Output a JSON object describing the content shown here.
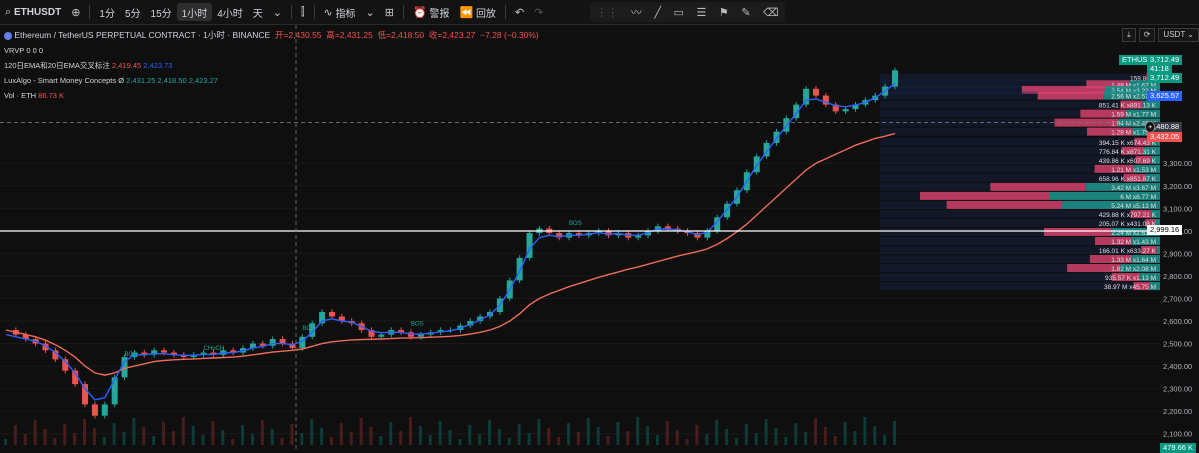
{
  "toolbar": {
    "symbol": "ETHUSDT",
    "intervals": [
      "1分",
      "5分",
      "15分",
      "1小时",
      "4小时",
      "天"
    ],
    "active_interval": "1小时",
    "indicators_label": "指标",
    "alert_label": "警报",
    "replay_label": "回放"
  },
  "legend": {
    "title": "Ethereum / TetherUS PERPETUAL CONTRACT · 1小时 · BINANCE",
    "ohlc": {
      "open_label": "开=",
      "open": "2,430.55",
      "high_label": "高=",
      "high": "2,431.25",
      "low_label": "低=",
      "low": "2,418.50",
      "close_label": "收=",
      "close": "2,423.27",
      "change": "−7.28 (−0.30%)"
    },
    "vrvp": {
      "name": "VRVP",
      "values": "0 0 0"
    },
    "ema": {
      "name": "120日EMA和20日EMA交叉标注",
      "v1": "2,419.45",
      "v2": "2,423.73"
    },
    "luxalgo": {
      "name": "LuxAlgo - Smart Money Concepts",
      "sym": "Ø",
      "values": "2,431.25  2,418.50  2,423.27"
    },
    "vol": {
      "name": "Vol · ETH",
      "value": "86.73 K"
    }
  },
  "right_panel": {
    "currency": "USDT"
  },
  "price_labels": {
    "symbol_tag": "ETHUSDT.P",
    "last_price": "3,712.49",
    "countdown": "41:18",
    "current": "3,712.49",
    "ema_blue": "3,625.57",
    "crosshair": "3,480.88",
    "ema_red": "3,432.05",
    "white_line": "2,999.16",
    "volume": "479.66 K"
  },
  "price_axis": {
    "ticks": [
      {
        "label": "3,300.00",
        "v": 3300
      },
      {
        "label": "3,200.00",
        "v": 3200
      },
      {
        "label": "3,100.00",
        "v": 3100
      },
      {
        "label": "3,000.00",
        "v": 3000
      },
      {
        "label": "2,900.00",
        "v": 2900
      },
      {
        "label": "2,800.00",
        "v": 2800
      },
      {
        "label": "2,700.00",
        "v": 2700
      },
      {
        "label": "2,600.00",
        "v": 2600
      },
      {
        "label": "2,500.00",
        "v": 2500
      },
      {
        "label": "2,400.00",
        "v": 2400
      },
      {
        "label": "2,300.00",
        "v": 2300
      },
      {
        "label": "2,200.00",
        "v": 2200
      },
      {
        "label": "2,100.00",
        "v": 2100
      }
    ]
  },
  "colors": {
    "up": "#26a69a",
    "down": "#ef5350",
    "ema_fast": "#2962ff",
    "ema_slow": "#ef6b5b",
    "vp_pink": "#d4426f",
    "vp_teal": "#1f8f8a",
    "vp_navy": "#1a2a5a"
  },
  "chart_data": {
    "type": "line",
    "title": "Ethereum / TetherUS PERPETUAL CONTRACT · 1小时 · BINANCE",
    "ylim": [
      2050,
      3780
    ],
    "price_path": [
      2560,
      2540,
      2520,
      2500,
      2470,
      2430,
      2380,
      2320,
      2230,
      2180,
      2230,
      2350,
      2440,
      2460,
      2450,
      2470,
      2460,
      2450,
      2440,
      2450,
      2460,
      2450,
      2470,
      2460,
      2480,
      2500,
      2490,
      2520,
      2500,
      2480,
      2530,
      2590,
      2640,
      2620,
      2600,
      2590,
      2560,
      2530,
      2540,
      2560,
      2550,
      2530,
      2540,
      2550,
      2560,
      2560,
      2580,
      2600,
      2620,
      2640,
      2700,
      2780,
      2880,
      2990,
      3010,
      2990,
      2970,
      2990,
      2980,
      2990,
      3000,
      2980,
      2990,
      2970,
      2980,
      3000,
      3020,
      3010,
      3000,
      2990,
      2970,
      3000,
      3060,
      3120,
      3180,
      3260,
      3330,
      3390,
      3440,
      3500,
      3560,
      3630,
      3600,
      3560,
      3530,
      3540,
      3560,
      3580,
      3600,
      3640,
      3712
    ],
    "ema20": [
      2540,
      2530,
      2520,
      2510,
      2490,
      2460,
      2420,
      2370,
      2300,
      2250,
      2260,
      2340,
      2420,
      2450,
      2450,
      2455,
      2455,
      2450,
      2448,
      2448,
      2452,
      2452,
      2458,
      2460,
      2468,
      2480,
      2488,
      2500,
      2500,
      2495,
      2510,
      2550,
      2600,
      2610,
      2600,
      2595,
      2575,
      2555,
      2548,
      2550,
      2550,
      2542,
      2542,
      2546,
      2552,
      2556,
      2568,
      2585,
      2605,
      2628,
      2670,
      2740,
      2820,
      2920,
      2970,
      2980,
      2975,
      2980,
      2980,
      2985,
      2992,
      2985,
      2988,
      2980,
      2980,
      2992,
      3008,
      3008,
      3004,
      2996,
      2983,
      2994,
      3040,
      3095,
      3150,
      3220,
      3290,
      3350,
      3410,
      3465,
      3520,
      3580,
      3585,
      3570,
      3555,
      3550,
      3558,
      3570,
      3590,
      3620,
      3655
    ],
    "ema120": [
      2560,
      2550,
      2540,
      2530,
      2515,
      2495,
      2470,
      2440,
      2400,
      2370,
      2360,
      2370,
      2390,
      2400,
      2410,
      2420,
      2425,
      2428,
      2430,
      2432,
      2434,
      2436,
      2438,
      2440,
      2444,
      2450,
      2456,
      2462,
      2466,
      2470,
      2476,
      2488,
      2500,
      2508,
      2512,
      2516,
      2518,
      2519,
      2520,
      2522,
      2524,
      2525,
      2526,
      2528,
      2530,
      2532,
      2536,
      2542,
      2550,
      2560,
      2576,
      2600,
      2632,
      2672,
      2700,
      2720,
      2736,
      2752,
      2766,
      2780,
      2794,
      2806,
      2818,
      2830,
      2840,
      2852,
      2864,
      2876,
      2888,
      2898,
      2908,
      2920,
      2940,
      2966,
      2996,
      3030,
      3070,
      3110,
      3150,
      3190,
      3230,
      3270,
      3300,
      3320,
      3340,
      3360,
      3380,
      3395,
      3410,
      3420,
      3432
    ],
    "volume_profile": [
      {
        "label": "159.86 K",
        "vp": 3680,
        "buy": 0.1,
        "sell": 0.02
      },
      {
        "label": "1.48 M  x1.67 M",
        "vp": 3650,
        "buy": 0.28,
        "sell": 0.33
      },
      {
        "label": "2.54 M  x3.22 M",
        "vp": 3625,
        "buy": 0.5,
        "sell": 0.64
      },
      {
        "label": "2.56 M  x2.57 M",
        "vp": 3600,
        "buy": 0.51,
        "sell": 0.51
      },
      {
        "label": "851.41 K  x891.13 K",
        "vp": 3560,
        "buy": 0.16,
        "sell": 0.17
      },
      {
        "label": "1.59 M  x1.77 M",
        "vp": 3520,
        "buy": 0.31,
        "sell": 0.35
      },
      {
        "label": "1.94 M  x2.46 M",
        "vp": 3480,
        "buy": 0.38,
        "sell": 0.49
      },
      {
        "label": "1.28 M  x1.75 M",
        "vp": 3440,
        "buy": 0.25,
        "sell": 0.35
      },
      {
        "label": "394.15 K  x674.43 K",
        "vp": 3395,
        "buy": 0.08,
        "sell": 0.13
      },
      {
        "label": "776.84 K  x871.31 K",
        "vp": 3355,
        "buy": 0.15,
        "sell": 0.17
      },
      {
        "label": "439.86 K  x607.69 K",
        "vp": 3315,
        "buy": 0.08,
        "sell": 0.12
      },
      {
        "label": "1.21 M  x1.53 M",
        "vp": 3275,
        "buy": 0.24,
        "sell": 0.3
      },
      {
        "label": "658.96 K  x851.87 K",
        "vp": 3235,
        "buy": 0.13,
        "sell": 0.17
      },
      {
        "label": "3.42 M  x3.67 M",
        "vp": 3195,
        "buy": 0.68,
        "sell": 0.73
      },
      {
        "label": "6 M  x6.77 M",
        "vp": 3155,
        "buy": 1.0,
        "sell": 1.0
      },
      {
        "label": "5.24 M  x5.13 M",
        "vp": 3115,
        "buy": 0.9,
        "sell": 0.88
      },
      {
        "label": "429.88 K  x797.21 K",
        "vp": 3075,
        "buy": 0.08,
        "sell": 0.16
      },
      {
        "label": "205.07 K  x431.08 K",
        "vp": 3035,
        "buy": 0.04,
        "sell": 0.08
      },
      {
        "label": "2.24 M  x2.63 M",
        "vp": 2995,
        "buy": 0.44,
        "sell": 0.52
      },
      {
        "label": "1.32 M  x1.43 M",
        "vp": 2955,
        "buy": 0.26,
        "sell": 0.28
      },
      {
        "label": "166.01 K  x633.27 K",
        "vp": 2915,
        "buy": 0.03,
        "sell": 0.12
      },
      {
        "label": "1.33 M  x1.64 M",
        "vp": 2875,
        "buy": 0.26,
        "sell": 0.32
      },
      {
        "label": "1.82 M  x2.08 M",
        "vp": 2835,
        "buy": 0.36,
        "sell": 0.41
      },
      {
        "label": "935.57 K  x1.13 M",
        "vp": 2795,
        "buy": 0.18,
        "sell": 0.22
      },
      {
        "label": "38.97 M  x45.75 M",
        "vp": 2755,
        "buy": 0.1,
        "sell": 0.12
      }
    ],
    "annotations": [
      {
        "text": "BOS",
        "at": 12,
        "v": 2445
      },
      {
        "text": "BOS",
        "at": 30,
        "v": 2560
      },
      {
        "text": "BOS",
        "at": 41,
        "v": 2580
      },
      {
        "text": "BOS",
        "at": 57,
        "v": 3025
      },
      {
        "text": "CHoCH",
        "at": 20,
        "v": 2472
      }
    ]
  }
}
